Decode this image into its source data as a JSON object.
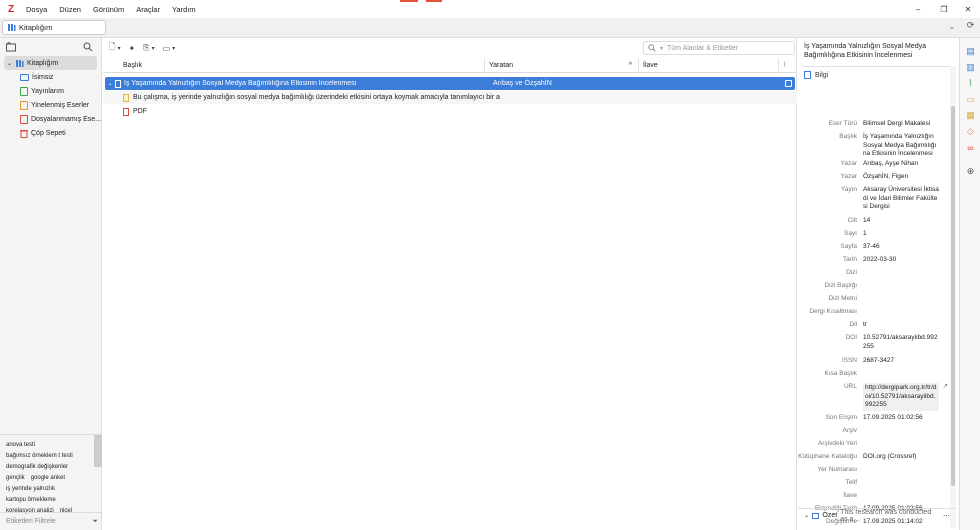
{
  "menubar": {
    "logo": "Z",
    "items": [
      "Dosya",
      "Düzen",
      "Görünüm",
      "Araçlar",
      "Yardım"
    ]
  },
  "tab": {
    "label": "Kitaplığım"
  },
  "left": {
    "library": "Kitaplığım",
    "collections": [
      "İsimsiz",
      "Yayınlarım",
      "Yinelenmiş Eserler",
      "Dosyalanmamış Ese...",
      "Çöp Sepeti"
    ],
    "tags": [
      [
        "anova testi"
      ],
      [
        "bağımsız örneklem t testi"
      ],
      [
        "demografik değişkenler"
      ],
      [
        "gençlik",
        "google anket"
      ],
      [
        "iş yerinde yalnızlık"
      ],
      [
        "kartopu örnekleme"
      ],
      [
        "korelasyon analizi",
        "nicel"
      ]
    ],
    "tag_filter_placeholder": "Etiketleri Filtrele"
  },
  "middle": {
    "search_placeholder": "Tüm Alanlar & Etiketler",
    "columns": {
      "title": "Başlık",
      "creator": "Yaratan",
      "extra": "İlave"
    },
    "rows": [
      {
        "title": "İş Yaşamında Yalnızlığın Sosyal Medya Bağımlılığına Etkisinin İncelenmesi",
        "creator": "Arıbaş ve ÖzşahİN"
      },
      {
        "title": "Bu çalışma, iş yerinde yalnızlığın sosyal medya bağımlılığı üzerindeki etkisini ortaya koymak amacıyla tanımlayıcı bir a"
      },
      {
        "title": "PDF"
      }
    ]
  },
  "right": {
    "title": "İş Yaşamında Yalnızlığın Sosyal Medya Bağımlılığına Etkisinin İncelenmesi",
    "section_info": "Bilgi",
    "fields": [
      {
        "label": "Eser Türü",
        "value": "Bilimsel Dergi Makalesi"
      },
      {
        "label": "Başlık",
        "value": "İş Yaşamında Yalnızlığın Sosyal Medya Bağımlılığına Etkisinin İncelenmesi"
      },
      {
        "label": "Yazar",
        "value": "Arıbaş, Ayşe Nihan"
      },
      {
        "label": "Yazar",
        "value": "ÖzşahİN, Figen"
      },
      {
        "label": "Yayın",
        "value": "Aksaray Üniversitesi İktisadi ve İdari Bilimler Fakültesi Dergisi"
      },
      {
        "label": "Cilt",
        "value": "14"
      },
      {
        "label": "Sayı",
        "value": "1"
      },
      {
        "label": "Sayfa",
        "value": "37-46"
      },
      {
        "label": "Tarih",
        "value": "2022-03-30"
      },
      {
        "label": "Dizi",
        "value": ""
      },
      {
        "label": "Dizi Başlığı",
        "value": ""
      },
      {
        "label": "Dizi Metni",
        "value": ""
      },
      {
        "label": "Dergi Kısaltması",
        "value": ""
      },
      {
        "label": "Dil",
        "value": "tr"
      },
      {
        "label": "DOI",
        "value": "10.52791/aksarayiibd.992255"
      },
      {
        "label": "ISSN",
        "value": "2687-3427"
      },
      {
        "label": "Kısa Başlık",
        "value": ""
      },
      {
        "label": "URL",
        "value": "http://dergipark.org.tr/tr/doi/10.52791/aksarayiibd.992255"
      },
      {
        "label": "Son Erişim",
        "value": "17.09.2025 01:02:56"
      },
      {
        "label": "Arşiv",
        "value": ""
      },
      {
        "label": "Arşivdeki Yeri",
        "value": ""
      },
      {
        "label": "Kütüphane Kataloğu",
        "value": "DOI.org (Crossref)"
      },
      {
        "label": "Yer Numarası",
        "value": ""
      },
      {
        "label": "Telif",
        "value": ""
      },
      {
        "label": "İlave",
        "value": ""
      },
      {
        "label": "Eklendiği Tarih",
        "value": "17.09.2025 01:02:56"
      },
      {
        "label": "Değiştirme",
        "value": "17.09.2025 01:14:02"
      }
    ],
    "abstract_label": "Özet",
    "abstract_preview": "This research was conducted as a..."
  },
  "colors": {
    "accent": "#3b7dd8",
    "brand": "#cc2936"
  }
}
